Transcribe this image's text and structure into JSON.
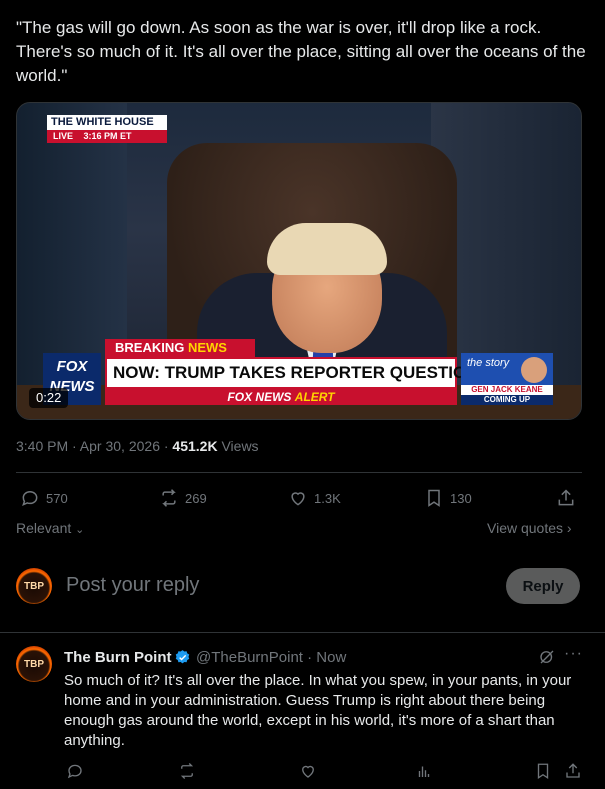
{
  "tweet": {
    "text": "\"The gas will go down. As soon as the war is over, it'll drop like a rock. There's so much of it. It's all over the place, sitting all over the oceans of the world.\"",
    "time": "3:40 PM · Apr 30, 2026 · ",
    "views_count": "451.2K",
    "views_label": " Views"
  },
  "video": {
    "badge_title": "THE WHITE HOUSE",
    "badge_live": "LIVE",
    "badge_time": "3:16 PM ET",
    "breaking": "BREAKING",
    "breaking_news": "NEWS",
    "headline": "NOW: TRUMP TAKES REPORTER QUESTIONS",
    "alert_prefix": "FOX NEWS",
    "alert_word": "ALERT",
    "logo_line1": "FOX",
    "logo_line2": "NEWS",
    "story_label": "the story",
    "story_name": "GEN JACK KEANE",
    "story_coming": "COMING UP",
    "duration": "0:22"
  },
  "actions": {
    "replies": "570",
    "reposts": "269",
    "likes": "1.3K",
    "bookmarks": "130"
  },
  "sort": {
    "label": "Relevant",
    "quotes_label": "View quotes"
  },
  "composer": {
    "avatar_text": "TBP",
    "placeholder": "Post your reply",
    "button": "Reply"
  },
  "reply": {
    "avatar_text": "TBP",
    "name": "The Burn Point",
    "handle": "@TheBurnPoint · Now",
    "text": "So much of it? It's all over the place. In what you spew, in your pants, in your home and in your administration. Guess Trump is right about there being enough gas around the world, except in his world, it's more of a shart than anything.",
    "more": "···"
  },
  "colors": {
    "background": "#000000",
    "text": "#e7e9ea",
    "muted": "#71767b",
    "verified": "#1d9bf0",
    "divider": "#2f3336"
  }
}
